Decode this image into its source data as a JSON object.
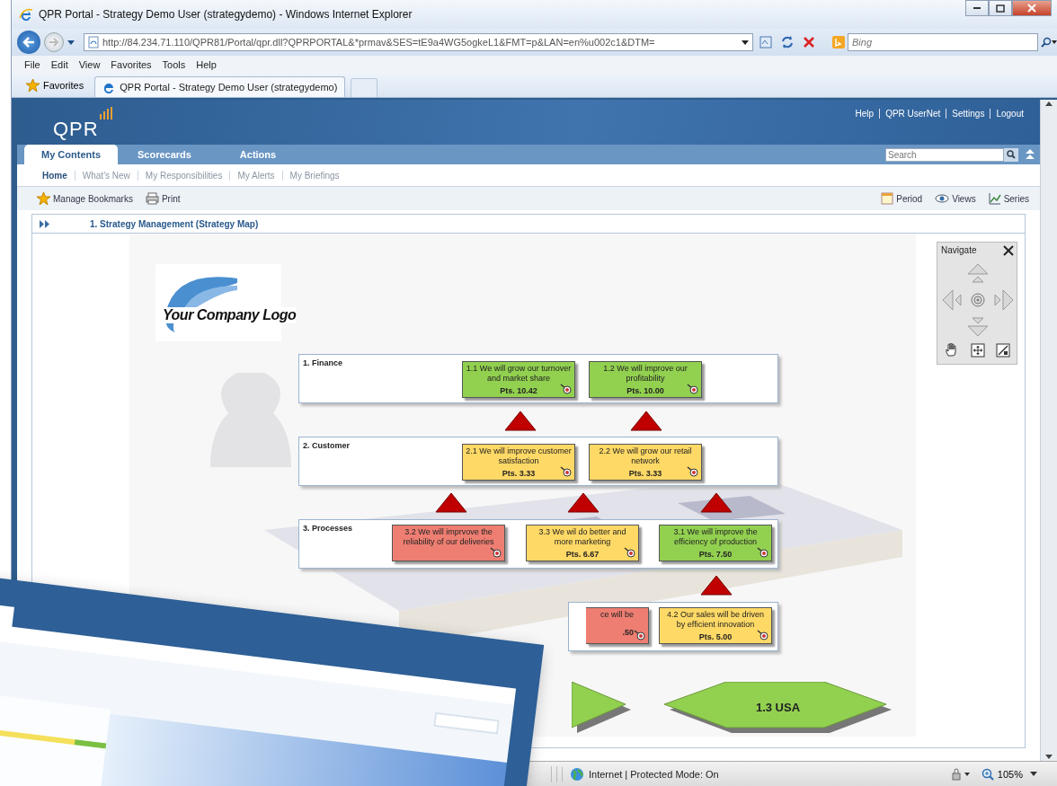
{
  "browser": {
    "title": "QPR Portal - Strategy Demo User (strategydemo) - Windows Internet Explorer",
    "address": "http://84.234.71.110/QPR81/Portal/qpr.dll?QPRPORTAL&*prmav&SES=tE9a4WG5ogkeL1&FMT=p&LAN=en%u002c1&DTM=",
    "search_placeholder": "Bing",
    "menu": [
      "File",
      "Edit",
      "View",
      "Favorites",
      "Tools",
      "Help"
    ],
    "favorites": "Favorites",
    "tab_title": "QPR Portal - Strategy Demo User (strategydemo)"
  },
  "portal": {
    "logo": "QPR",
    "header_links": [
      "Help",
      "QPR UserNet",
      "Settings",
      "Logout"
    ],
    "tabs": [
      {
        "label": "My Contents",
        "selected": true
      },
      {
        "label": "Scorecards",
        "selected": false
      },
      {
        "label": "Actions",
        "selected": false
      }
    ],
    "search_placeholder": "Search",
    "subnav": [
      {
        "label": "Home",
        "selected": true
      },
      {
        "label": "What's New",
        "selected": false
      },
      {
        "label": "My Responsibilities",
        "selected": false
      },
      {
        "label": "My Alerts",
        "selected": false
      },
      {
        "label": "My Briefings",
        "selected": false
      }
    ],
    "toolbar_left": [
      "Manage Bookmarks",
      "Print"
    ],
    "toolbar_right": [
      "Period",
      "Views",
      "Series"
    ],
    "breadcrumb": "1. Strategy Management (Strategy Map)"
  },
  "map": {
    "logo_text": "Your Company Logo",
    "perspectives": [
      {
        "label": "1. Finance",
        "objectives": [
          {
            "kind": "full",
            "title": "1.1 We will grow our turnover and market share",
            "points": "Pts. 10.42",
            "color": "#92d050"
          },
          {
            "kind": "full",
            "title": "1.2 We will improve our profitability",
            "points": "Pts. 10.00",
            "color": "#92d050"
          }
        ]
      },
      {
        "label": "2. Customer",
        "objectives": [
          {
            "kind": "full",
            "title": "2.1 We will improve customer satisfaction",
            "points": "Pts. 3.33",
            "color": "#ffd966"
          },
          {
            "kind": "full",
            "title": "2.2 We will grow our retail network",
            "points": "Pts. 3.33",
            "color": "#ffd966"
          }
        ]
      },
      {
        "label": "3. Processes",
        "objectives": [
          {
            "kind": "full",
            "title": "3.2 We will imprvove the reliability of our deliveries",
            "color": "#ee7e72"
          },
          {
            "kind": "full",
            "title": "3.3 We wil do better and more marketing",
            "points": "Pts. 6.67",
            "color": "#ffd966"
          },
          {
            "kind": "full",
            "title": "3.1 We will improve the efficiency of production",
            "points": "Pts. 7.50",
            "color": "#92d050"
          }
        ]
      },
      {
        "objectives": [
          {
            "kind": "partial",
            "title": "ce will be",
            "points": ".50",
            "color": "#ee7e72"
          },
          {
            "kind": "full",
            "title": "4.2 Our sales will be driven by efficient innovation",
            "points": "Pts. 5.00",
            "color": "#ffd966"
          }
        ]
      }
    ],
    "hexagons": [
      {
        "label": "1.3 USA"
      }
    ],
    "navigate": {
      "title": "Navigate"
    }
  },
  "status_bar": {
    "zone": "Internet | Protected Mode: On",
    "zoom": "105%"
  }
}
